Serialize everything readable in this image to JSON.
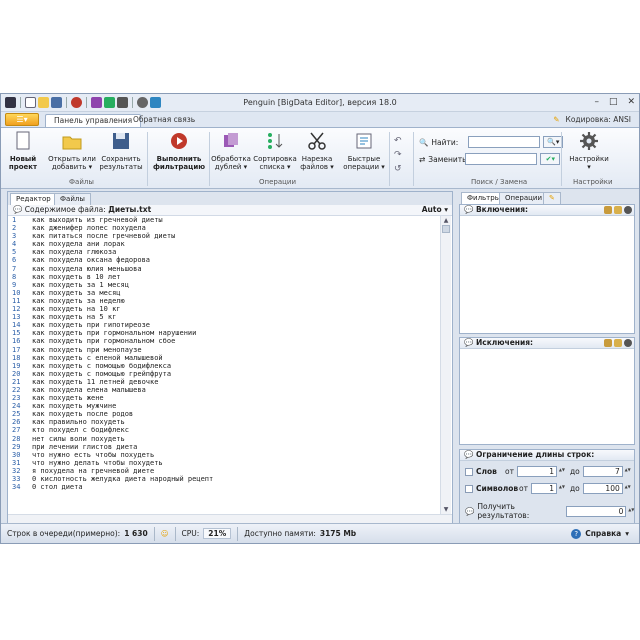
{
  "window": {
    "title": "Penguin [BigData Editor], версия 18.0",
    "controls": [
      "–",
      "□",
      "✕"
    ]
  },
  "ribbon_tabs": {
    "active": "Панель управления",
    "other": "Обратная связь",
    "encoding_label": "Кодировка: ANSI"
  },
  "ribbon": {
    "new_project": "Новый проект",
    "open_add": "Открыть или добавить",
    "save_results": "Сохранить результаты",
    "run_filter": "Выполнить фильтрацию",
    "dedupe": "Обработка дублей",
    "sort_list": "Сортировка списка",
    "cut_files": "Нарезка файлов",
    "quick_ops": "Быстрые операции",
    "find_label": "Найти:",
    "replace_label": "Заменить:",
    "settings": "Настройки",
    "groups": {
      "files": "Файлы",
      "operations": "Операции",
      "find_replace": "Поиск / Замена",
      "settings": "Настройки"
    }
  },
  "editor": {
    "tabs": [
      "Редактор",
      "Файлы"
    ],
    "file_label": "Содержимое файла:",
    "file_name": "Диеты.txt",
    "mode": "Auto",
    "lines": [
      "как выходить из гречневой диеты",
      "как дженифер лопес похудела",
      "как питаться после гречневой диеты",
      "как похудела ани лорак",
      "как похудела глюкоза",
      "как похудела оксана федорова",
      "как похудела юлия меньшова",
      "как похудеть в 10 лет",
      "как похудеть за 1 месяц",
      "как похудеть за месяц",
      "как похудеть за неделю",
      "как похудеть на 10 кг",
      "как похудеть на 5 кг",
      "как похудеть при гипотиреозе",
      "как похудеть при гормональном нарушении",
      "как похудеть при гормональном сбое",
      "как похудеть при менопаузе",
      "как похудеть с еленой малышевой",
      "как похудеть с помощью бодифлекса",
      "как похудеть с помощью грейпфрута",
      "как похудеть 11 летней девочке",
      "как похудела елена малышева",
      "как похудеть жене",
      "как похудеть мужчине",
      "как похудеть после родов",
      "как правильно похудеть",
      "кто похудел с бодифлекс",
      "нет силы воли похудеть",
      "при лечении глистов диета",
      "что нужно есть чтобы похудеть",
      "что нужно делать чтобы похудеть",
      "я похудела на гречневой диете",
      "0 кислотность желудка диета народный рецепт",
      "0 стол диета"
    ]
  },
  "right_panel": {
    "tabs": [
      "Фильтры",
      "Операции"
    ],
    "includes_label": "Включения:",
    "excludes_label": "Исключения:",
    "length_header": "Ограничение длины строк:",
    "words_label": "Слов",
    "symbols_label": "Символов",
    "from": "от",
    "to": "до",
    "words_from": "1",
    "words_to": "7",
    "symbols_from": "1",
    "symbols_to": "100",
    "get_results_label": "Получить результатов:",
    "get_results_value": "0"
  },
  "status": {
    "queue_label": "Строк в очереди(примерно):",
    "queue_value": "1 630",
    "cpu_label": "CPU:",
    "cpu_value": "21%",
    "mem_label": "Доступно памяти:",
    "mem_value": "3175 Mb",
    "help": "Справка"
  },
  "colors": {
    "accent": "#f0a020",
    "line_numbers": "#2b5fa8",
    "ribbon_border": "#9fb2cb"
  }
}
